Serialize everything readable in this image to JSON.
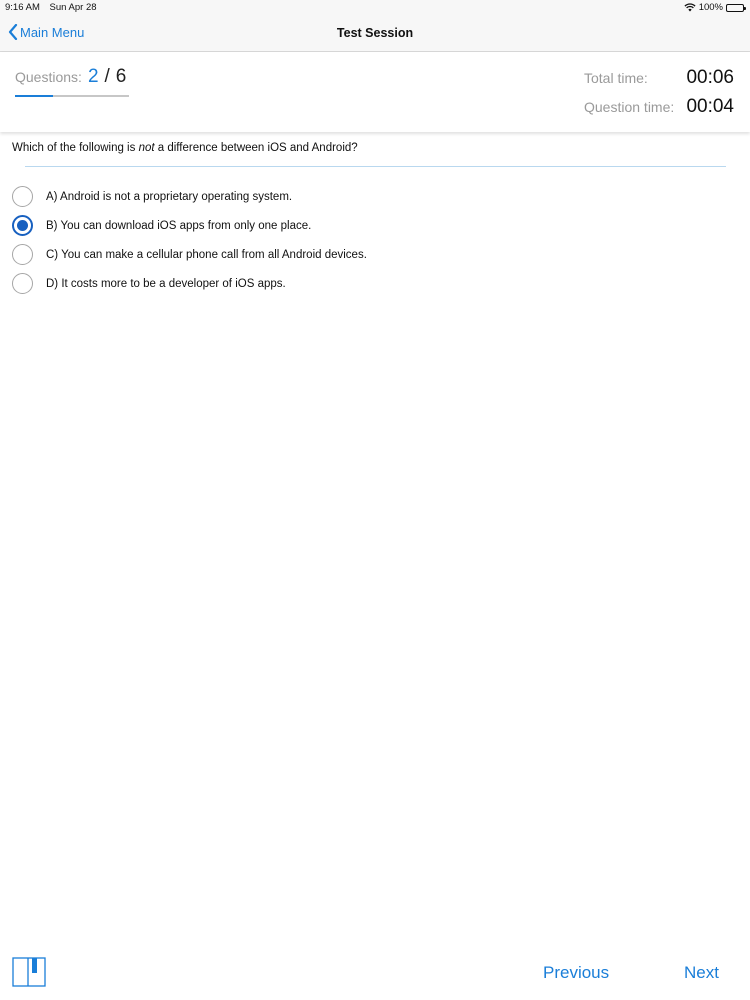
{
  "status_bar": {
    "time": "9:16 AM",
    "date": "Sun Apr 28",
    "battery": "100%",
    "icons": [
      "wifi-icon",
      "battery-icon"
    ]
  },
  "navbar": {
    "back_label": "Main Menu",
    "title": "Test Session"
  },
  "progress": {
    "label": "Questions:",
    "current": "2",
    "separator": "/",
    "total": "6",
    "fraction_complete": 0.33
  },
  "timers": {
    "total_label": "Total time:",
    "total_value": "00:06",
    "question_label": "Question time:",
    "question_value": "00:04"
  },
  "question": {
    "prefix": "Which of the following is ",
    "emphasis": "not",
    "suffix": " a difference between iOS and Android?"
  },
  "answers": [
    {
      "label": "A) Android is not a proprietary operating system.",
      "selected": false
    },
    {
      "label": "B) You can download iOS apps from only one place.",
      "selected": true
    },
    {
      "label": "C) You can make a cellular phone call from all Android devices.",
      "selected": false
    },
    {
      "label": "D) It costs more to be a developer of iOS apps.",
      "selected": false
    }
  ],
  "bottom": {
    "previous_label": "Previous",
    "next_label": "Next",
    "bookmark_icon": "bookmark-icon"
  },
  "colors": {
    "accent": "#1a7ed8",
    "radio_selected": "#1760c0"
  }
}
